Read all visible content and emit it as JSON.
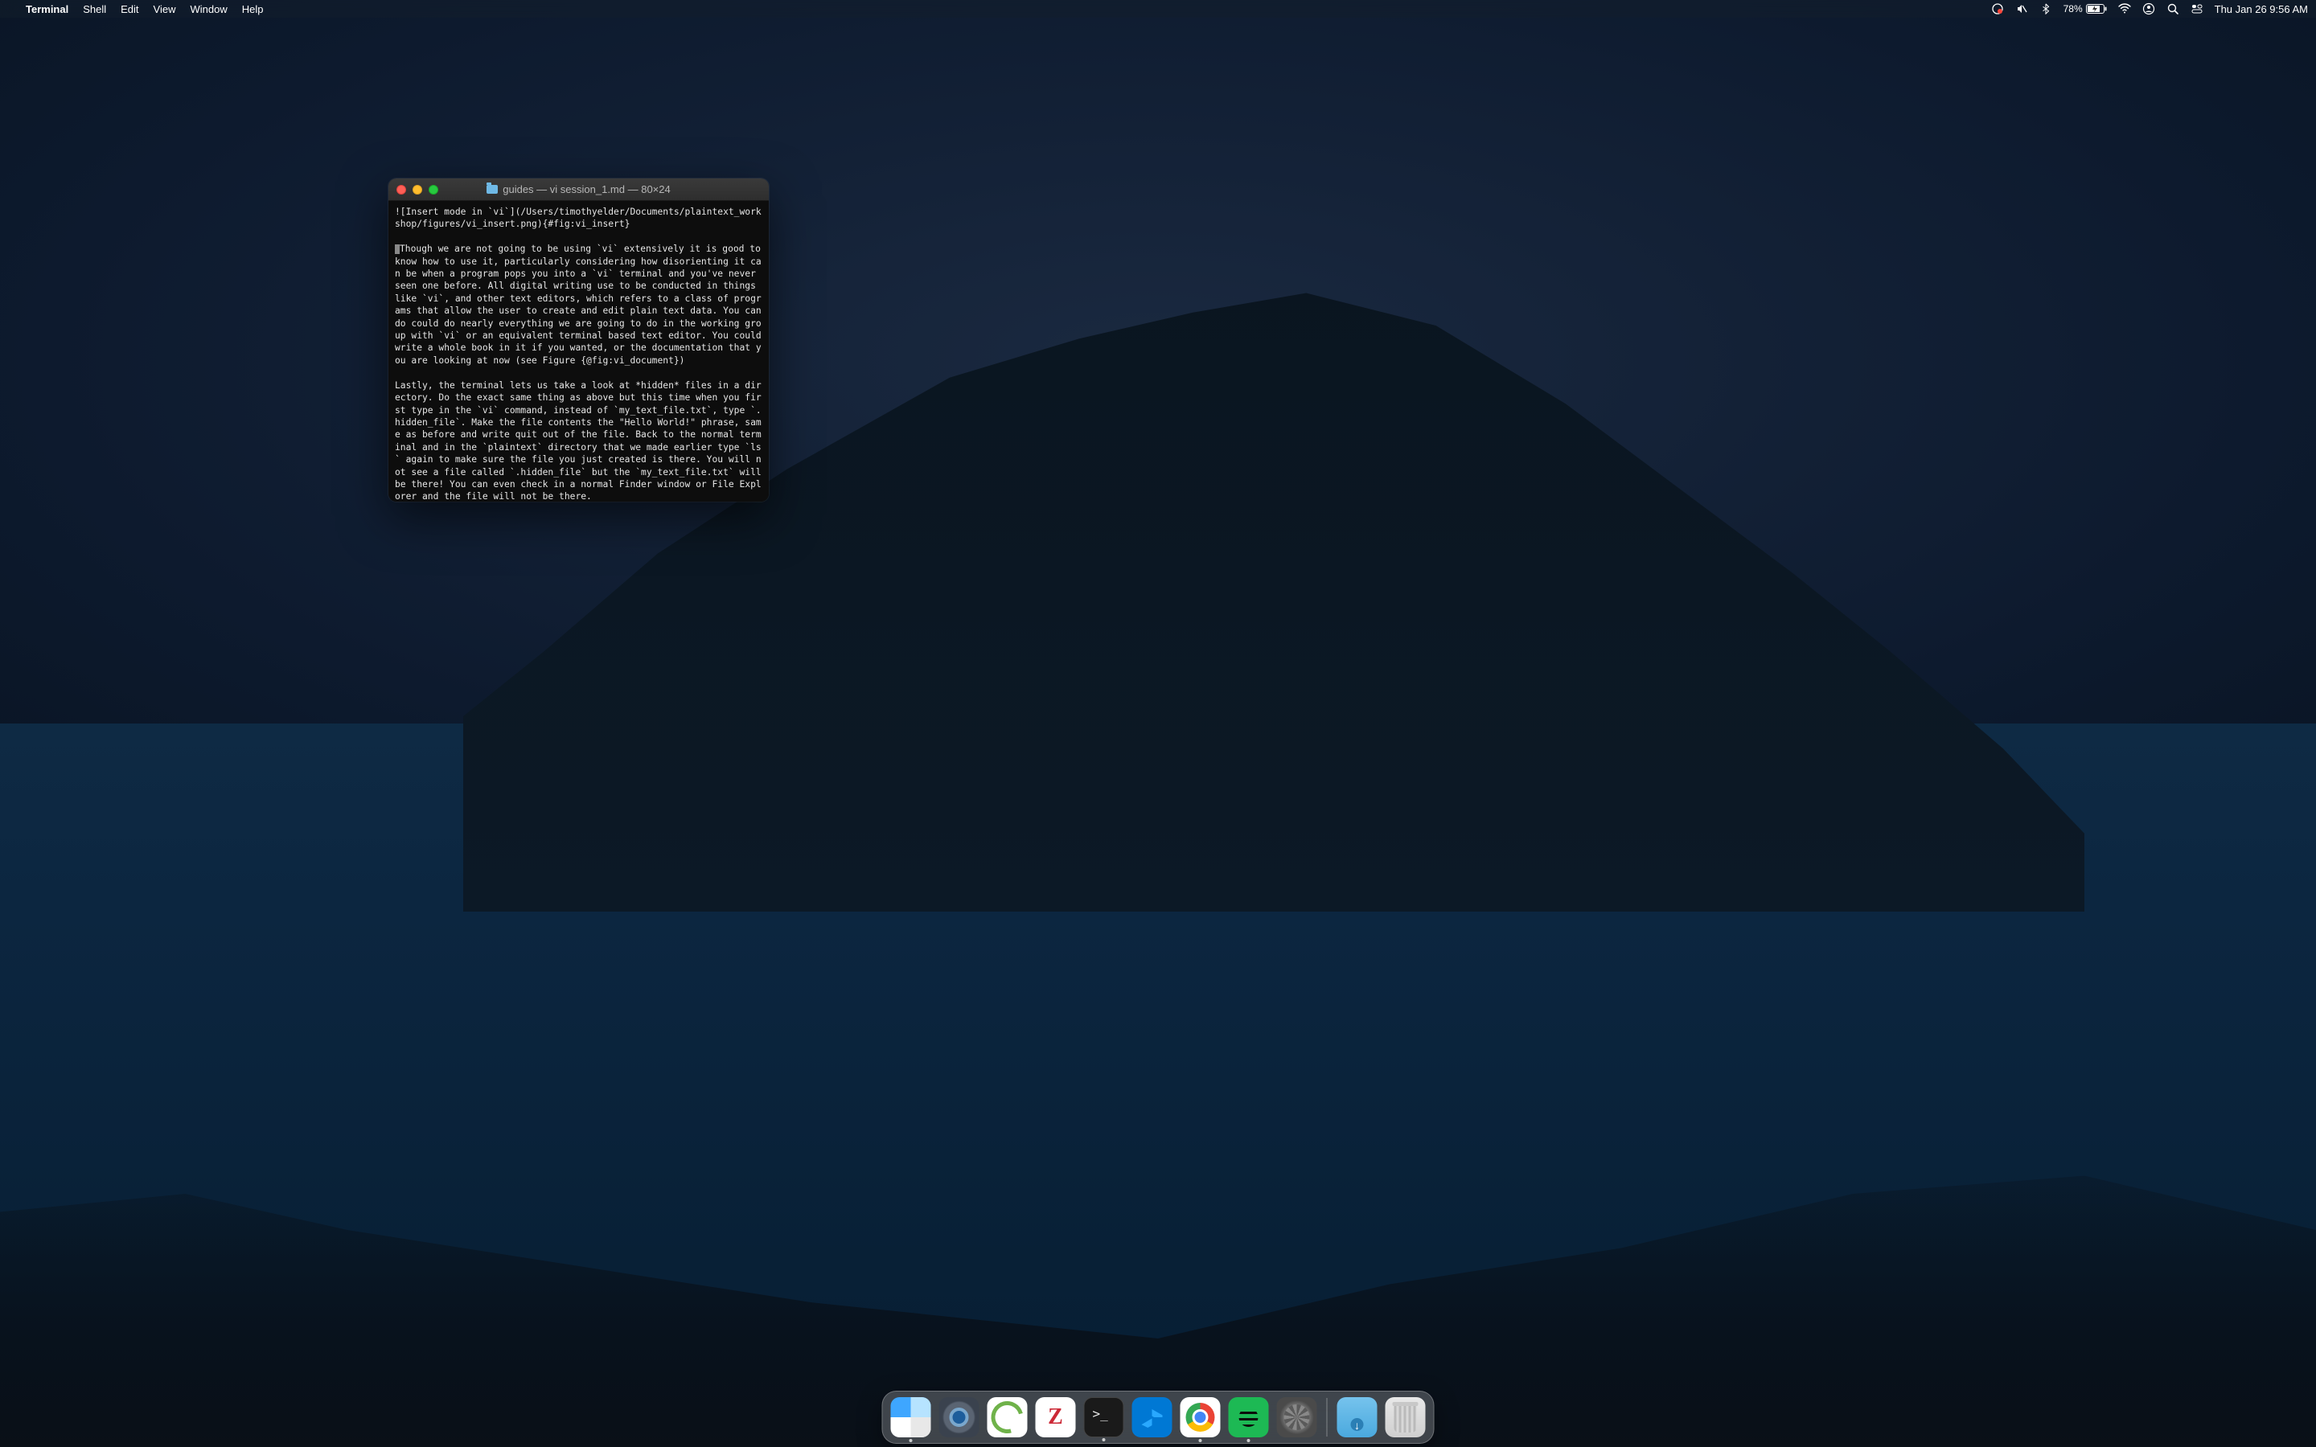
{
  "menubar": {
    "app_name": "Terminal",
    "items": [
      "Shell",
      "Edit",
      "View",
      "Window",
      "Help"
    ],
    "battery_percent": "78%",
    "datetime": "Thu Jan 26  9:56 AM"
  },
  "terminal": {
    "title": "guides — vi session_1.md — 80×24",
    "content_line_img": "![Insert mode in `vi`](/Users/timothyelder/Documents/plaintext_workshop/figures/vi_insert.png){#fig:vi_insert}",
    "content_para1": "Though we are not going to be using `vi` extensively it is good to know how to use it, particularly considering how disorienting it can be when a program pops you into a `vi` terminal and you've never seen one before. All digital writing use to be conducted in things like `vi`, and other text editors, which refers to a class of programs that allow the user to create and edit plain text data. You can do could do nearly everything we are going to do in the working group with `vi` or an equivalent terminal based text editor. You could write a whole book in it if you wanted, or the documentation that you are looking at now (see Figure {@fig:vi_document})",
    "content_para2": "Lastly, the terminal lets us take a look at *hidden* files in a directory. Do the exact same thing as above but this time when you first type in the `vi` command, instead of `my_text_file.txt`, type `.hidden_file`. Make the file contents the \"Hello World!\" phrase, same as before and write quit out of the file. Back to the normal terminal and in the `plaintext` directory that we made earlier type `ls` again to make sure the file you just created is there. You will not see a file called `.hidden_file` but the `my_text_file.txt` will be there! You can even check in a normal Finder window or File Explorer and the file will not be there."
  },
  "dock": {
    "apps": [
      {
        "name": "Finder",
        "running": true
      },
      {
        "name": "QuickTime Player",
        "running": false
      },
      {
        "name": "Cisco AnyConnect",
        "running": false
      },
      {
        "name": "Zotero",
        "running": false
      },
      {
        "name": "Terminal",
        "running": true
      },
      {
        "name": "Visual Studio Code",
        "running": false
      },
      {
        "name": "Google Chrome",
        "running": true
      },
      {
        "name": "Spotify",
        "running": true
      },
      {
        "name": "System Preferences",
        "running": false
      }
    ],
    "zotero_letter": "Z",
    "right": [
      {
        "name": "Downloads"
      },
      {
        "name": "Trash"
      }
    ]
  }
}
